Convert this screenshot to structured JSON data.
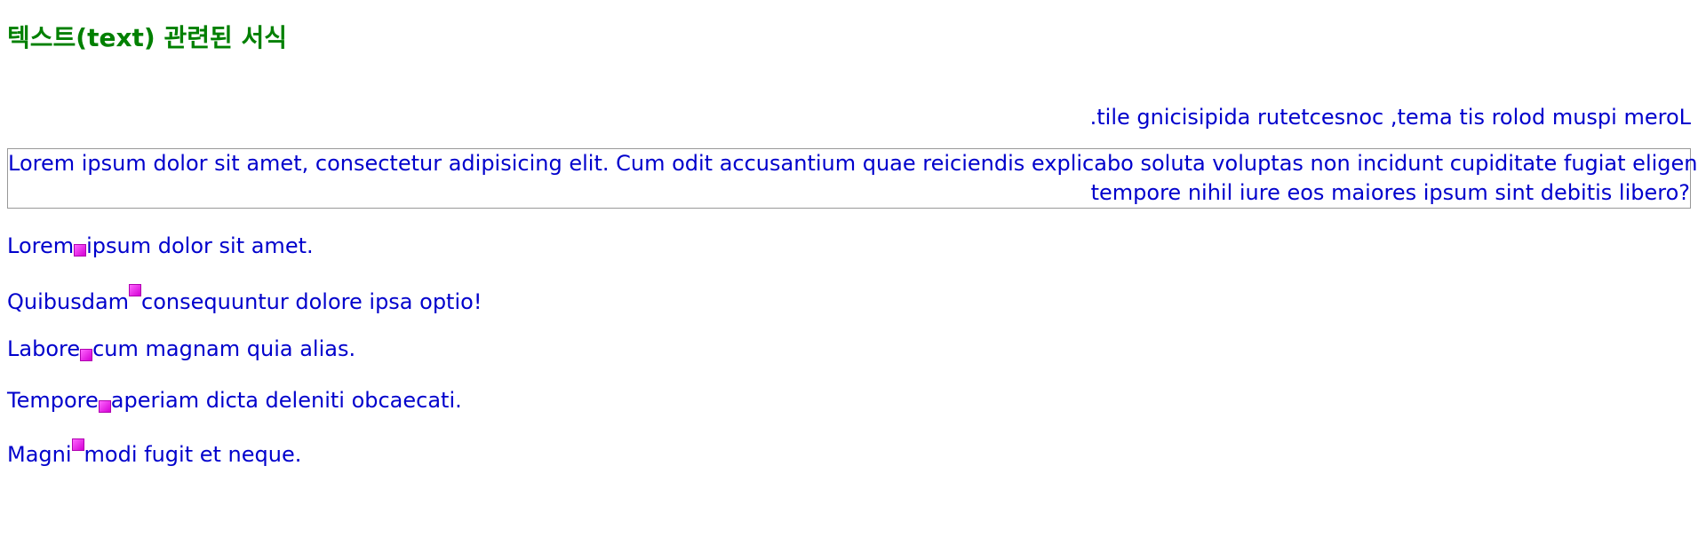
{
  "heading": "텍스트(text) 관련된 서식",
  "reversed_line": ".tile gnicisipida rutetcesnoc ,tema tis rolod muspi meroL",
  "bordered_block": {
    "line1": "Lorem ipsum dolor sit amet, consectetur adipisicing elit. Cum odit accusantium quae reiciendis explicabo soluta voluptas non incidunt cupiditate fugiat eligendi",
    "line2": "tempore nihil iure eos maiores ipsum sint debitis libero?"
  },
  "rows": [
    {
      "before": "Lorem",
      "after": "ipsum dolor sit amet."
    },
    {
      "before": "Quibusdam",
      "after": "consequuntur dolore ipsa optio!"
    },
    {
      "before": "Labore",
      "after": "cum magnam quia alias."
    },
    {
      "before": "Tempore",
      "after": "aperiam dicta deleniti obcaecati."
    },
    {
      "before": "Magni",
      "after": "modi fugit et neque."
    }
  ],
  "colors": {
    "heading": "#008000",
    "text": "#0000cc",
    "square": "#e020e0",
    "border": "#999999"
  },
  "icons": {
    "inline_square": "magenta-square-icon"
  }
}
